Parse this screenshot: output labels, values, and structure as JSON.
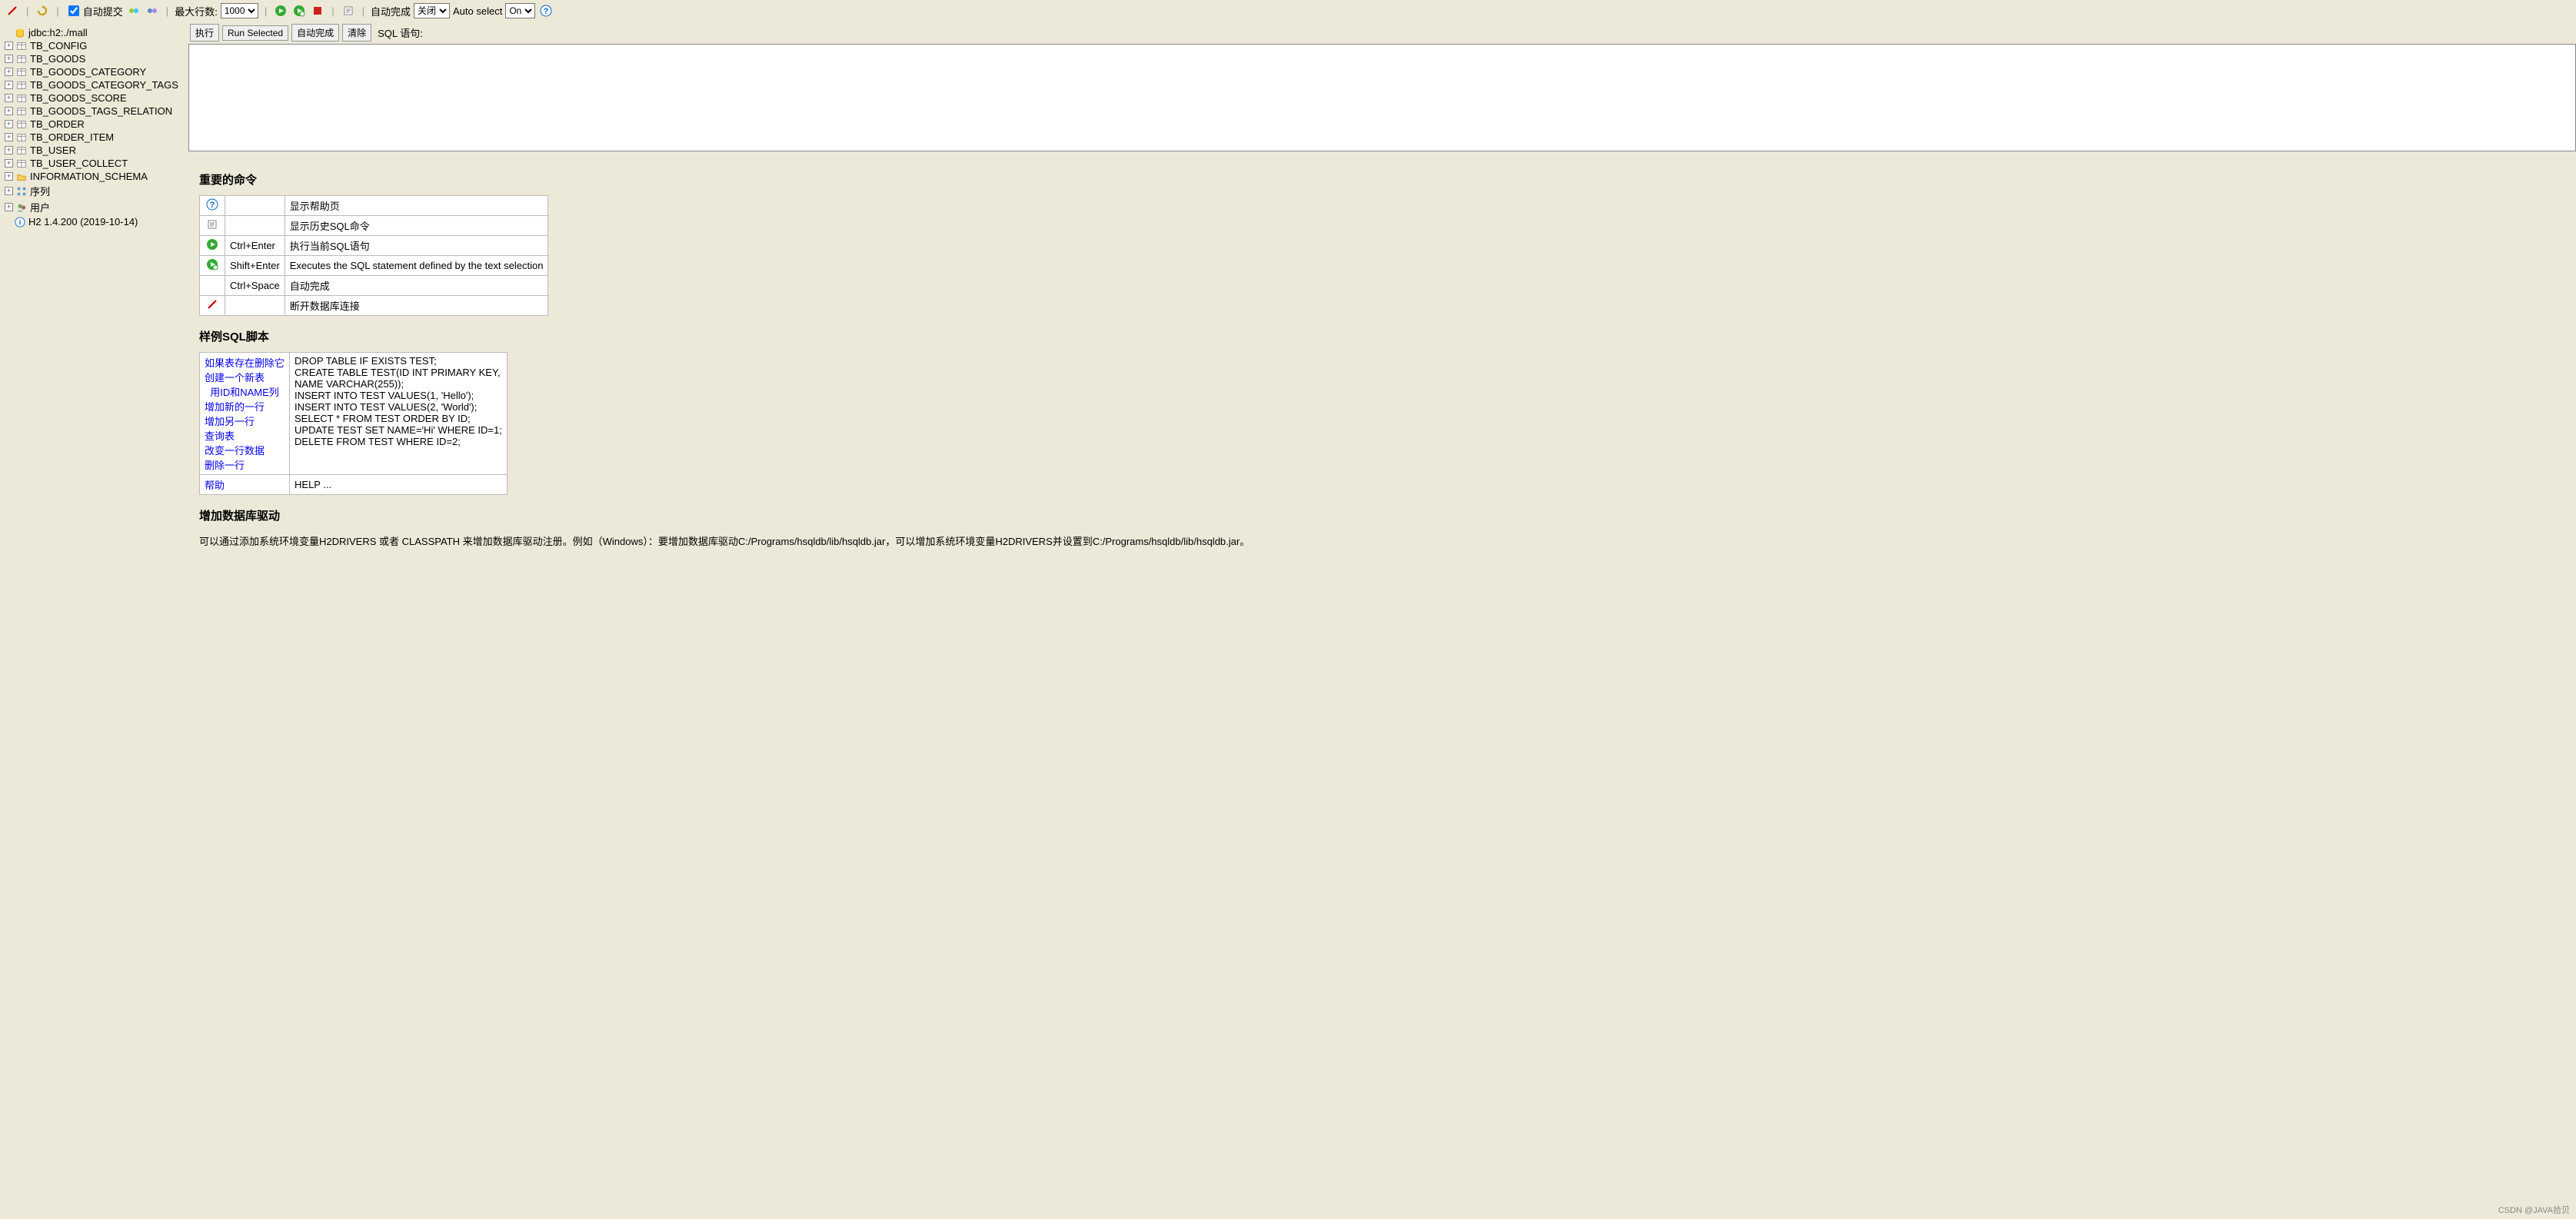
{
  "toolbar": {
    "auto_commit_label": "自动提交",
    "auto_commit_checked": true,
    "max_rows_label": "最大行数:",
    "max_rows_value": "1000",
    "auto_complete_label": "自动完成",
    "auto_complete_value": "关闭",
    "auto_select_label": "Auto select",
    "auto_select_value": "On"
  },
  "sidebar": {
    "connection_label": "jdbc:h2:./mall",
    "tables": [
      "TB_CONFIG",
      "TB_GOODS",
      "TB_GOODS_CATEGORY",
      "TB_GOODS_CATEGORY_TAGS",
      "TB_GOODS_SCORE",
      "TB_GOODS_TAGS_RELATION",
      "TB_ORDER",
      "TB_ORDER_ITEM",
      "TB_USER",
      "TB_USER_COLLECT"
    ],
    "info_schema_label": "INFORMATION_SCHEMA",
    "sequences_label": "序列",
    "users_label": "用户",
    "version_label": "H2 1.4.200 (2019-10-14)"
  },
  "sqlbar": {
    "run_label": "执行",
    "run_selected_label": "Run Selected",
    "autocomplete_label": "自动完成",
    "clear_label": "清除",
    "statement_label": "SQL 语句:"
  },
  "help": {
    "heading_commands": "重要的命令",
    "rows": [
      {
        "icon": "help",
        "key": "",
        "desc": "显示帮助页"
      },
      {
        "icon": "history",
        "key": "",
        "desc": "显示历史SQL命令"
      },
      {
        "icon": "run",
        "key": "Ctrl+Enter",
        "desc": "执行当前SQL语句"
      },
      {
        "icon": "runsel",
        "key": "Shift+Enter",
        "desc": "Executes the SQL statement defined by the text selection"
      },
      {
        "icon": "",
        "key": "Ctrl+Space",
        "desc": "自动完成"
      },
      {
        "icon": "disconnect",
        "key": "",
        "desc": "断开数据库连接"
      }
    ],
    "heading_samples": "样例SQL脚本",
    "samples": [
      {
        "link": "如果表存在删除它",
        "sql": "DROP TABLE IF EXISTS TEST;"
      },
      {
        "link": "创建一个新表",
        "sql": "CREATE TABLE TEST(ID INT PRIMARY KEY,"
      },
      {
        "link": "  用ID和NAME列",
        "sql": "    NAME VARCHAR(255));"
      },
      {
        "link": "增加新的一行",
        "sql": "INSERT INTO TEST VALUES(1, 'Hello');"
      },
      {
        "link": "增加另一行",
        "sql": "INSERT INTO TEST VALUES(2, 'World');"
      },
      {
        "link": "查询表",
        "sql": "SELECT * FROM TEST ORDER BY ID;"
      },
      {
        "link": "改变一行数据",
        "sql": "UPDATE TEST SET NAME='Hi' WHERE ID=1;"
      },
      {
        "link": "删除一行",
        "sql": "DELETE FROM TEST WHERE ID=2;"
      }
    ],
    "sample_help_link": "帮助",
    "sample_help_sql": "HELP ...",
    "heading_driver": "增加数据库驱动",
    "driver_text": "可以通过添加系统环境变量H2DRIVERS 或者 CLASSPATH 来增加数据库驱动注册。例如（Windows）：要增加数据库驱动C:/Programs/hsqldb/lib/hsqldb.jar，可以增加系统环境变量H2DRIVERS并设置到C:/Programs/hsqldb/lib/hsqldb.jar。"
  },
  "footer": "CSDN @JAVA拾贝"
}
